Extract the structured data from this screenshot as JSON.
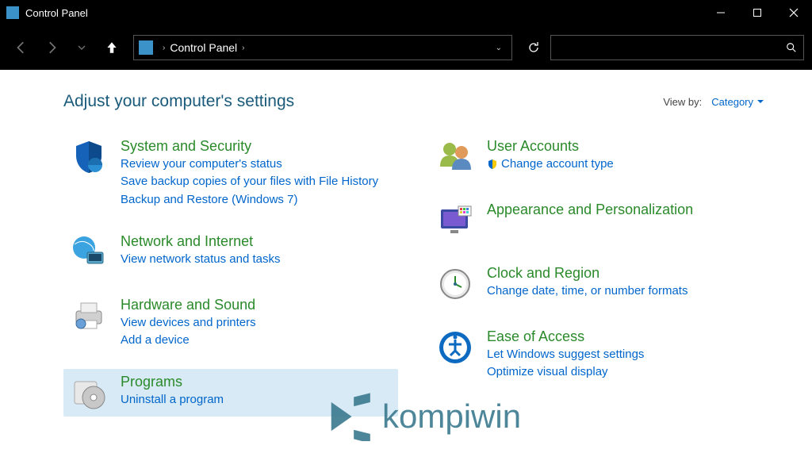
{
  "window": {
    "title": "Control Panel"
  },
  "nav": {
    "breadcrumb": "Control Panel"
  },
  "header": {
    "heading": "Adjust your computer's settings"
  },
  "viewBy": {
    "label": "View by:",
    "value": "Category"
  },
  "left": [
    {
      "id": "system-security",
      "title": "System and Security",
      "links": [
        "Review your computer's status",
        "Save backup copies of your files with File History",
        "Backup and Restore (Windows 7)"
      ]
    },
    {
      "id": "network-internet",
      "title": "Network and Internet",
      "links": [
        "View network status and tasks"
      ]
    },
    {
      "id": "hardware-sound",
      "title": "Hardware and Sound",
      "links": [
        "View devices and printers",
        "Add a device"
      ]
    },
    {
      "id": "programs",
      "title": "Programs",
      "links": [
        "Uninstall a program"
      ],
      "selected": true
    }
  ],
  "right": [
    {
      "id": "user-accounts",
      "title": "User Accounts",
      "links": [
        "Change account type"
      ],
      "uac": [
        true
      ]
    },
    {
      "id": "appearance-personalization",
      "title": "Appearance and Personalization",
      "links": []
    },
    {
      "id": "clock-region",
      "title": "Clock and Region",
      "links": [
        "Change date, time, or number formats"
      ]
    },
    {
      "id": "ease-of-access",
      "title": "Ease of Access",
      "links": [
        "Let Windows suggest settings",
        "Optimize visual display"
      ]
    }
  ],
  "watermark": "kompiwin"
}
